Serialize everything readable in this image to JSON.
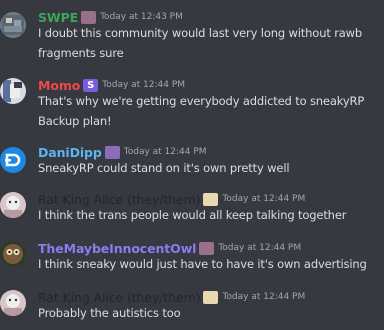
{
  "colors": {
    "background": "#36393f",
    "message_text": "#dcddde",
    "timestamp": "#a3a6aa"
  },
  "messages": [
    {
      "username": "SWPE",
      "username_color": "#3ba55d",
      "timestamp": "Today at 12:43 PM",
      "badge": "emoji-badge",
      "lines": [
        "I doubt this community would last very long without rawb",
        "fragments sure"
      ]
    },
    {
      "username": "Momo",
      "username_color": "#f04747",
      "timestamp": "Today at 12:44 PM",
      "badge": "s-badge",
      "lines": [
        "That's why we're getting everybody addicted to sneakyRP",
        "Backup plan!"
      ]
    },
    {
      "username": "DaniDipp",
      "username_color": "#5fb3f0",
      "timestamp": "Today at 12:44 PM",
      "badge": "emoji-badge",
      "lines": [
        "SneakyRP could stand on it's own pretty well"
      ]
    },
    {
      "username": "Rat King Alice (they/them)",
      "username_color": "#23272a",
      "timestamp": "Today at 12:44 PM",
      "badge": "note-badge",
      "lines": [
        "I think the trans people would all keep talking together"
      ]
    },
    {
      "username": "TheMaybeInnocentOwl",
      "username_color": "#8c7cf0",
      "timestamp": "Today at 12:44 PM",
      "badge": "emoji-badge",
      "lines": [
        "I think sneaky would just have to have it's own advertising"
      ]
    },
    {
      "username": "Rat King Alice (they/them)",
      "username_color": "#23272a",
      "timestamp": "Today at 12:44 PM",
      "badge": "note-badge",
      "lines": [
        "Probably the autistics too"
      ]
    }
  ]
}
